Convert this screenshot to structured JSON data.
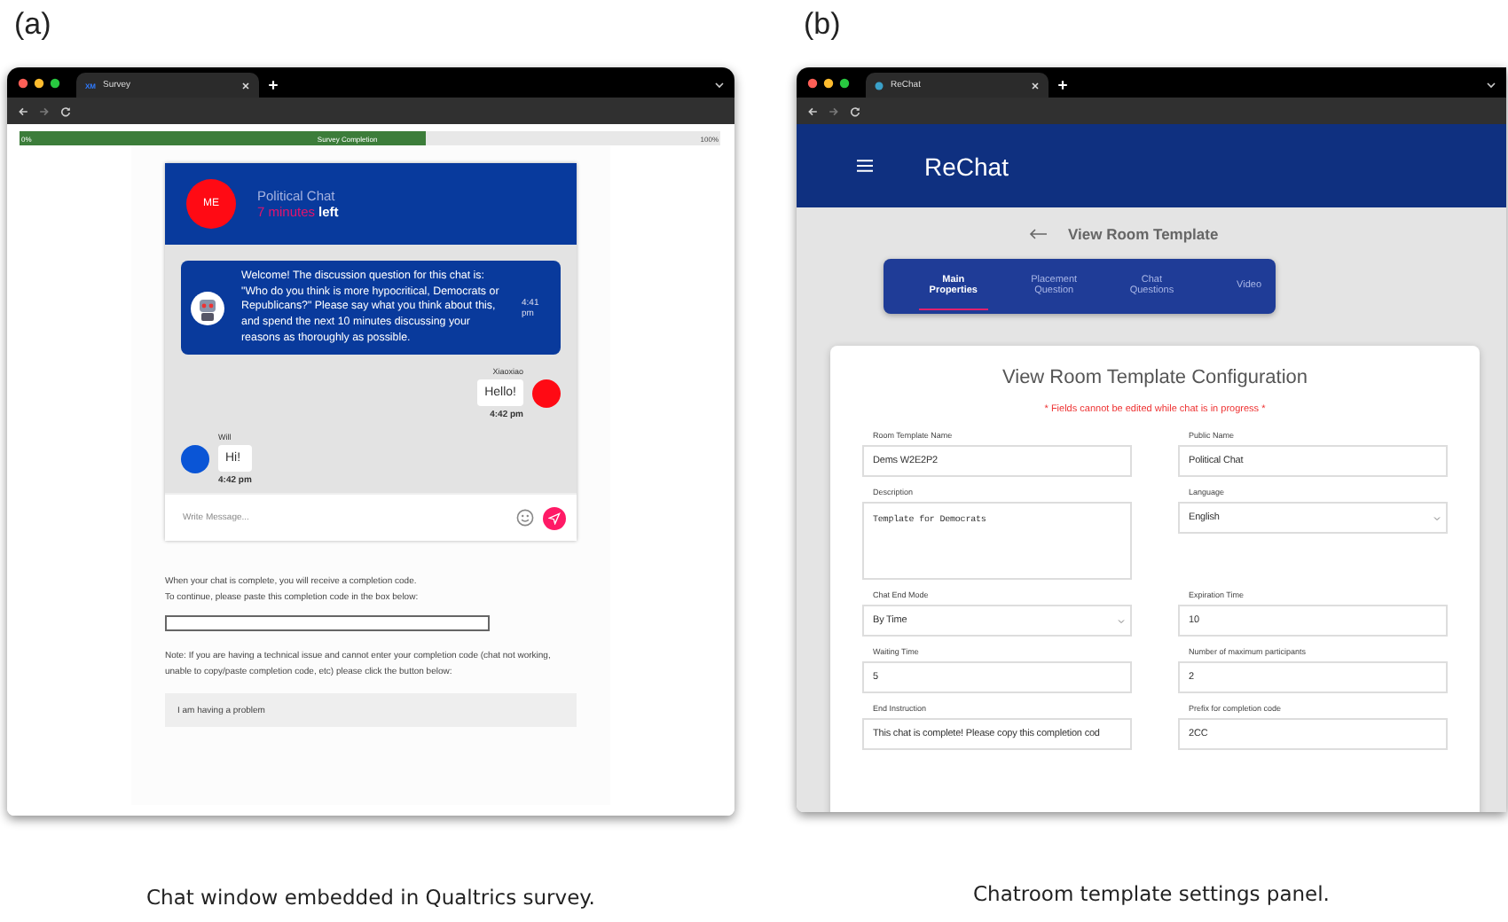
{
  "panels": [
    {
      "kind": "survey",
      "label": "(a)",
      "caption": "Chat window embedded in Qualtrics survey.",
      "browser": {
        "tab_icon": "XM",
        "tab_title": "Survey"
      },
      "progress": {
        "start": "0%",
        "label": "Survey Completion",
        "end": "100%",
        "level": 0.58
      },
      "chat": {
        "avatar": "ME",
        "title": "Political Chat",
        "time_left": "7 minutes",
        "time_suffix": "left",
        "messages": [
          {
            "kind": "bot",
            "text": "Welcome! The discussion question for this chat is: \"Who do you think is more hypocritical, Democrats or Republicans?\" Please say what you think about this, and spend the next 10 minutes discussing your reasons as thoroughly as possible.",
            "time": "4:41 pm"
          },
          {
            "kind": "outgoing",
            "sender": "Xiaoxiao",
            "text": "Hello!",
            "time": "4:42 pm",
            "color": "#ff0a14"
          },
          {
            "kind": "incoming",
            "sender": "Will",
            "text": "Hi!",
            "time": "4:42 pm",
            "color": "#0a55d6"
          }
        ],
        "composer": {
          "placeholder": "Write Message..."
        }
      },
      "instructions": [
        "When your chat is complete, you will receive a completion code.",
        "To continue, please paste this completion code in the box below:"
      ],
      "note": "Note: If you are having a technical issue and cannot enter your completion code (chat not working, unable to copy/paste completion code, etc) please click the button below:",
      "problem_button": "I am having a problem"
    },
    {
      "kind": "rechat",
      "label": "(b)",
      "caption": "Chatroom template settings panel.",
      "browser": {
        "tab_title": "ReChat"
      },
      "app_title": "ReChat",
      "page_title": "View Room Template",
      "tabs": [
        {
          "label": "Main Properties",
          "selected": true
        },
        {
          "label": "Placement Question",
          "selected": false
        },
        {
          "label": "Chat Questions",
          "selected": false
        },
        {
          "label": "Video",
          "selected": false
        }
      ],
      "card_title": "View Room Template Configuration",
      "warning": "* Fields cannot be edited while chat is in progress *",
      "fields": [
        {
          "kind": "text",
          "label": "Room Template Name",
          "value": "Dems W2E2P2"
        },
        {
          "kind": "text",
          "label": "Public Name",
          "value": "Political Chat"
        },
        {
          "kind": "textarea",
          "label": "Description",
          "value": "Template for Democrats"
        },
        {
          "kind": "select",
          "label": "Language",
          "value": "English"
        },
        {
          "kind": "select",
          "label": "Chat End Mode",
          "value": "By Time"
        },
        {
          "kind": "text",
          "label": "Expiration Time",
          "value": "10"
        },
        {
          "kind": "text",
          "label": "Waiting Time",
          "value": "5"
        },
        {
          "kind": "text",
          "label": "Number of maximum participants",
          "value": "2"
        },
        {
          "kind": "text",
          "label": "End Instruction",
          "value": "This chat is complete!  Please copy this completion cod"
        },
        {
          "kind": "text",
          "label": "Prefix for completion code",
          "value": "2CC"
        }
      ]
    }
  ]
}
